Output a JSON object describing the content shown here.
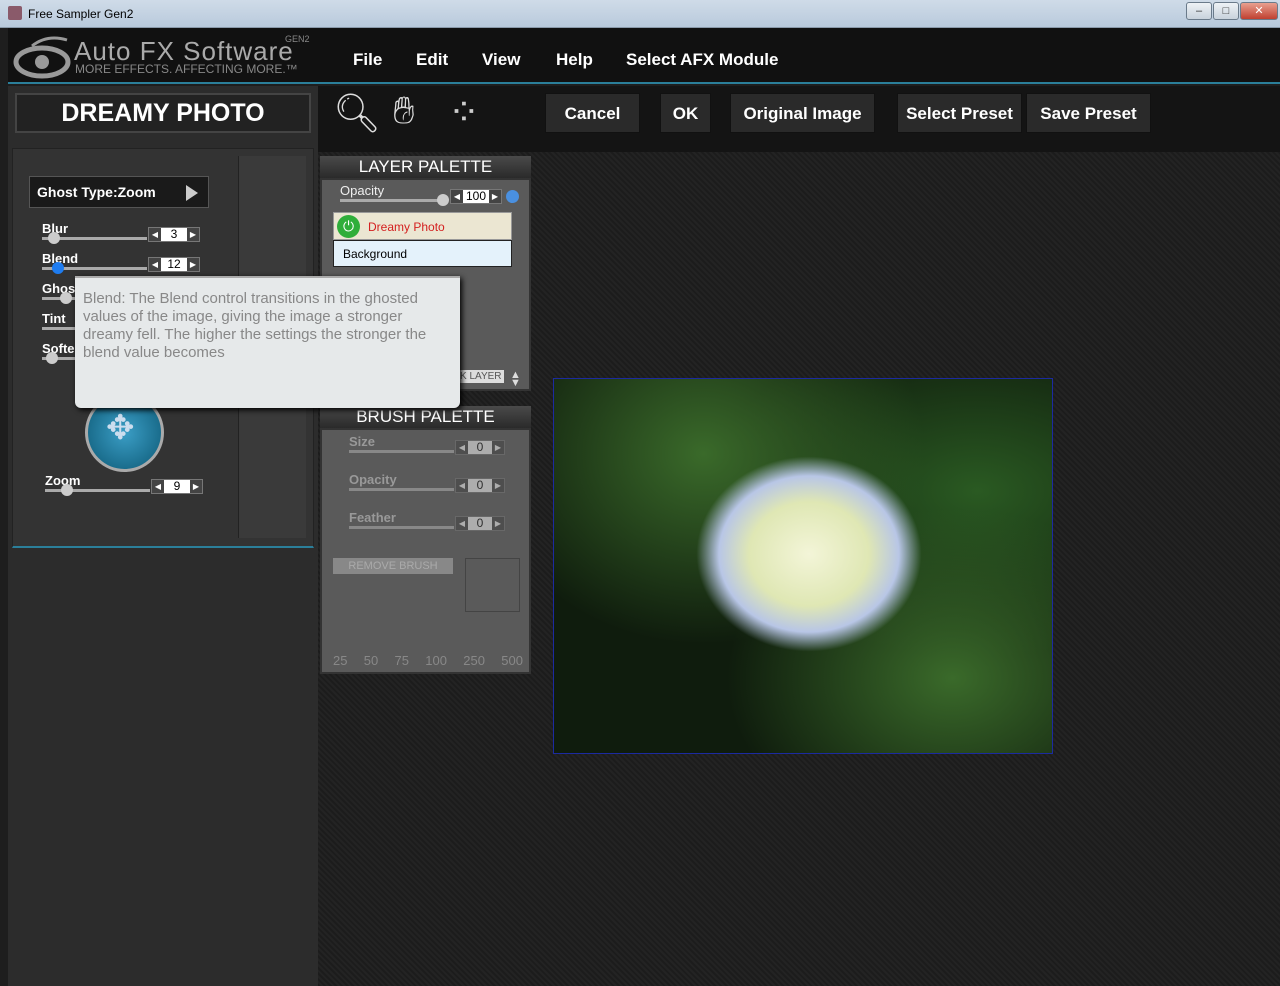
{
  "window": {
    "title": "Free Sampler Gen2",
    "minimize": "‒",
    "maximize": "□",
    "close": "✕"
  },
  "logo": {
    "brand": "Auto FX Software",
    "tagline": "MORE EFFECTS. AFFECTING MORE.™",
    "badge": "GEN2"
  },
  "menu": [
    "File",
    "Edit",
    "View",
    "Help",
    "Select AFX Module"
  ],
  "effect_title": "DREAMY PHOTO",
  "tools": [
    "zoom-tool",
    "hand-tool",
    "selection-tool"
  ],
  "buttons": {
    "cancel": "Cancel",
    "ok": "OK",
    "original": "Original Image",
    "select_preset": "Select Preset",
    "save_preset": "Save Preset"
  },
  "controls": {
    "ghost_type": "Ghost Type:Zoom",
    "sliders": [
      {
        "label": "Blur",
        "value": "3",
        "level": 0.08
      },
      {
        "label": "Blend",
        "value": "12",
        "level": 0.12
      },
      {
        "label": "Ghos",
        "value": "",
        "level": 0.2
      },
      {
        "label": "Tint",
        "value": "",
        "level": 0
      },
      {
        "label": "Softe",
        "value": "",
        "level": 0.1
      }
    ],
    "zoom": {
      "label": "Zoom",
      "value": "9",
      "level": 0.2
    }
  },
  "tooltip": "Blend: The Blend control transitions in the ghosted values of the image, giving the image a stronger dreamy fell. The higher the settings the stronger the blend value becomes",
  "layer_palette": {
    "title": "LAYER PALETTE",
    "opacity_label": "Opacity",
    "opacity_value": "100",
    "layers": [
      "Dreamy Photo",
      "Background"
    ],
    "layer_btn": "K LAYER"
  },
  "brush_palette": {
    "title": "BRUSH PALETTE",
    "sliders": [
      {
        "label": "Size",
        "value": "0"
      },
      {
        "label": "Opacity",
        "value": "0"
      },
      {
        "label": "Feather",
        "value": "0"
      }
    ],
    "remove": "REMOVE BRUSH",
    "sizes": [
      "25",
      "50",
      "75",
      "100",
      "250",
      "500"
    ]
  },
  "colors": {
    "accent": "#2b7f9a",
    "active_layer_text": "#d42020",
    "power_green": "#2fae3a"
  }
}
